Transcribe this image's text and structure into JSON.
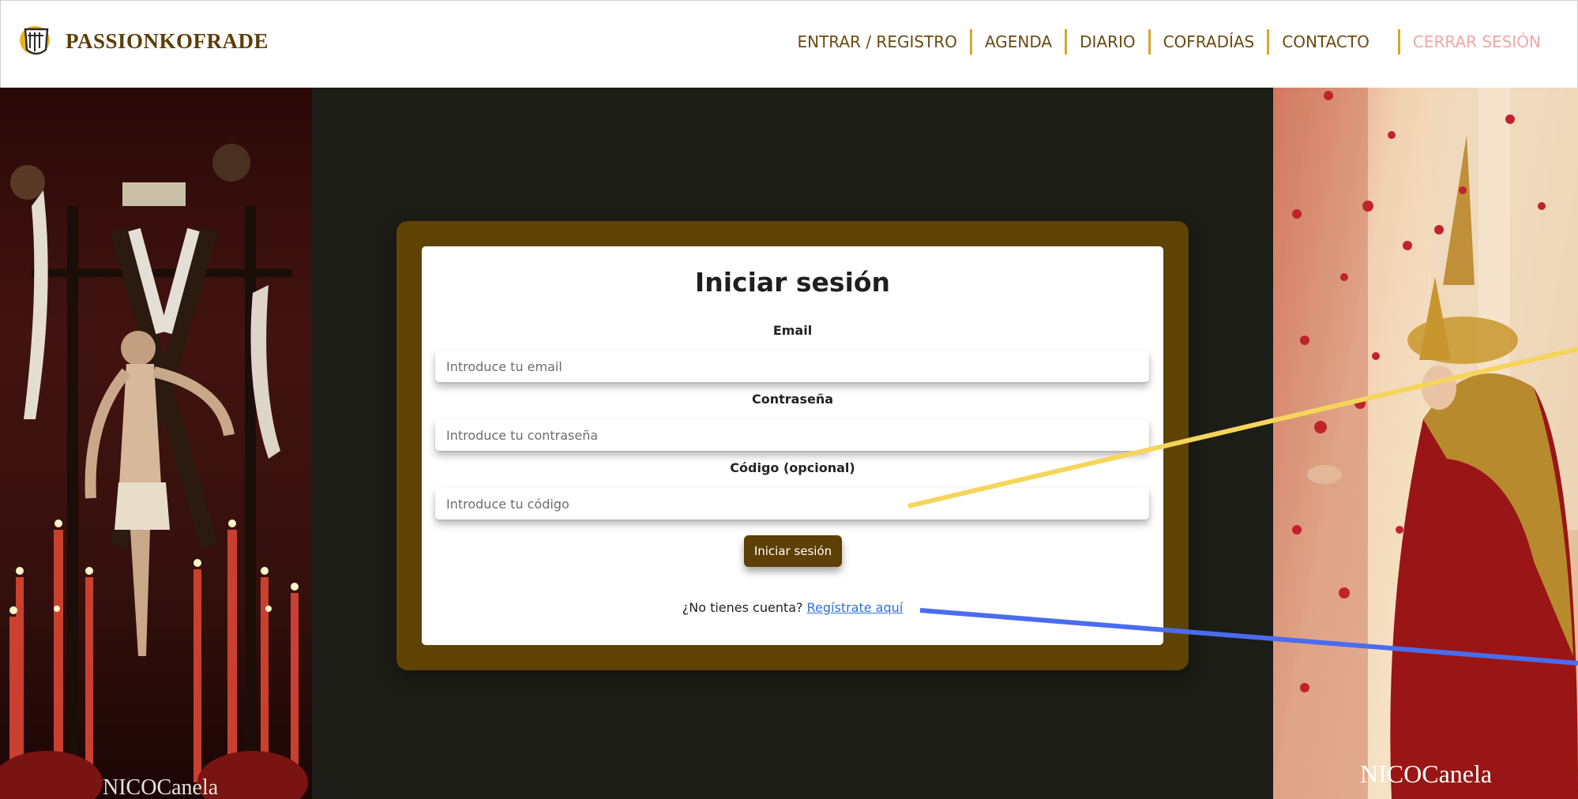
{
  "header": {
    "brand": "PASSIONKOFRADE",
    "nav": [
      {
        "label": "ENTRAR / REGISTRO"
      },
      {
        "label": "AGENDA"
      },
      {
        "label": "DIARIO"
      },
      {
        "label": "COFRADÍAS"
      },
      {
        "label": "CONTACTO"
      }
    ],
    "logout": "CERRAR SESIÓN"
  },
  "photos": {
    "left_watermark": "NICOCanela",
    "right_watermark": "NICOCanela"
  },
  "login": {
    "title": "Iniciar sesión",
    "email": {
      "label": "Email",
      "placeholder": "Introduce tu email",
      "value": ""
    },
    "password": {
      "label": "Contraseña",
      "placeholder": "Introduce tu contraseña",
      "value": ""
    },
    "code": {
      "label": "Código (opcional)",
      "placeholder": "Introduce tu código",
      "value": ""
    },
    "submit_label": "Iniciar sesión",
    "signup_prompt": "¿No tienes cuenta?",
    "signup_link": "Regístrate aquí"
  },
  "colors": {
    "brand": "#5c3d08",
    "nav_text": "#6a4a10",
    "nav_separator": "#d2a92b",
    "logout": "#f2a7a7",
    "card_frame": "#5e4305",
    "button": "#5e3f06",
    "link": "#2f6fe0",
    "background": "#1d1d18",
    "annotation_yellow": "#f5d55a",
    "annotation_blue": "#4a6cf0"
  }
}
